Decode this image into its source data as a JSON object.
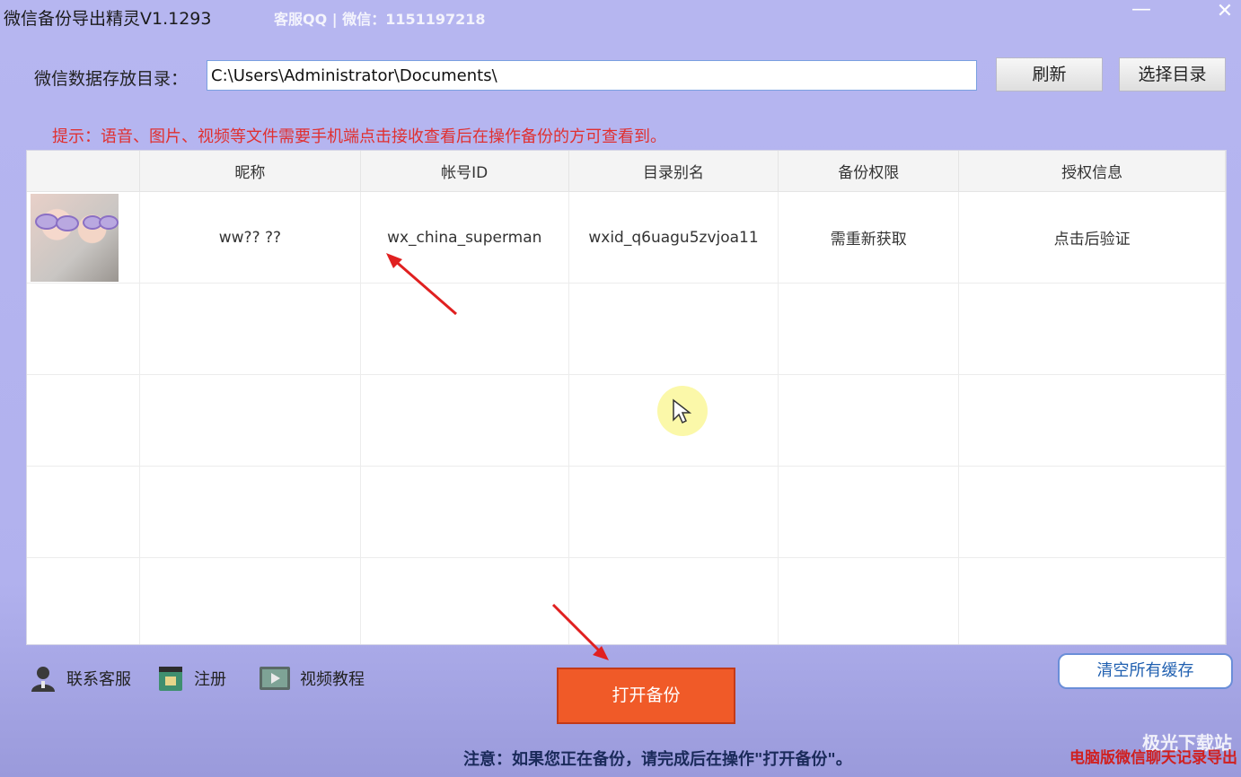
{
  "window": {
    "title": "微信备份导出精灵V1.1293",
    "support": "客服QQ | 微信：1151197218",
    "minimize_glyph": "—",
    "close_glyph": "✕"
  },
  "toolbar": {
    "dir_label": "微信数据存放目录：",
    "dir_value": "C:\\Users\\Administrator\\Documents\\",
    "refresh_label": "刷新",
    "select_dir_label": "选择目录"
  },
  "hint": "提示：语音、图片、视频等文件需要手机端点击接收查看后在操作备份的方可查看到。",
  "table": {
    "columns": [
      "",
      "昵称",
      "帐号ID",
      "目录别名",
      "备份权限",
      "授权信息"
    ],
    "rows": [
      {
        "avatar": "avatar-photo",
        "nickname": "ww?? ??",
        "account_id": "wx_china_superman",
        "dir_alias": "wxid_q6uagu5zvjoa11",
        "permission": "需重新获取",
        "auth_info": "点击后验证"
      }
    ]
  },
  "bottom": {
    "contact_label": "联系客服",
    "register_label": "注册",
    "video_label": "视频教程",
    "open_backup_label": "打开备份",
    "clear_cache_label": "清空所有缓存",
    "notice": "注意：如果您正在备份，请完成后在操作\"打开备份\"。",
    "export_link": "电脑版微信聊天记录导出",
    "watermark": "极光下载站"
  },
  "colors": {
    "background": "#b4b4ef",
    "hint": "#e03030",
    "open_button": "#f05a28",
    "annotation_arrow": "#e02020"
  },
  "icons": [
    "minimize-icon",
    "close-icon",
    "avatar-photo",
    "contact-service-icon",
    "register-icon",
    "video-tutorial-icon",
    "mouse-cursor-icon"
  ]
}
